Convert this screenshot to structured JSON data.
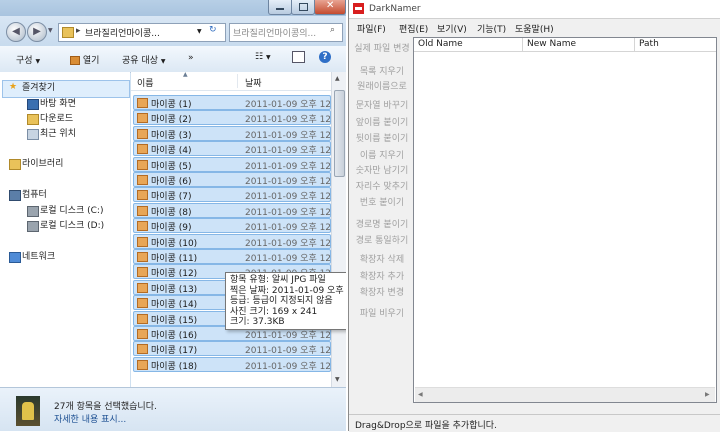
{
  "explorer": {
    "address": "브라질리언마이콩...",
    "search_placeholder": "브라질리언마이콩의...",
    "toolbar": {
      "organize": "구성",
      "open": "열기",
      "share": "공유 대상",
      "more": "»"
    },
    "nav": [
      {
        "label": "즐겨찾기",
        "icon": "star-icon"
      },
      {
        "label": "바탕 화면",
        "icon": "desktop-icon"
      },
      {
        "label": "다운로드",
        "icon": "download-icon"
      },
      {
        "label": "최근 위치",
        "icon": "recent-places-icon"
      },
      {
        "label": "라이브러리",
        "icon": "library-icon"
      },
      {
        "label": "컴퓨터",
        "icon": "computer-icon"
      },
      {
        "label": "로컬 디스크 (C:)",
        "icon": "drive-icon"
      },
      {
        "label": "로컬 디스크 (D:)",
        "icon": "drive-icon"
      },
      {
        "label": "네트워크",
        "icon": "network-icon"
      }
    ],
    "columns": {
      "name": "이름",
      "date": "날짜"
    },
    "files": [
      {
        "name": "마이콩 (1)",
        "date": "2011-01-09 오후 12:"
      },
      {
        "name": "마이콩 (2)",
        "date": "2011-01-09 오후 12:"
      },
      {
        "name": "마이콩 (3)",
        "date": "2011-01-09 오후 12:"
      },
      {
        "name": "마이콩 (4)",
        "date": "2011-01-09 오후 12:"
      },
      {
        "name": "마이콩 (5)",
        "date": "2011-01-09 오후 12:"
      },
      {
        "name": "마이콩 (6)",
        "date": "2011-01-09 오후 12:"
      },
      {
        "name": "마이콩 (7)",
        "date": "2011-01-09 오후 12:"
      },
      {
        "name": "마이콩 (8)",
        "date": "2011-01-09 오후 12:"
      },
      {
        "name": "마이콩 (9)",
        "date": "2011-01-09 오후 12:"
      },
      {
        "name": "마이콩 (10)",
        "date": "2011-01-09 오후 12:"
      },
      {
        "name": "마이콩 (11)",
        "date": "2011-01-09 오후 12:"
      },
      {
        "name": "마이콩 (12)",
        "date": "2011-01-09 오후 12:"
      },
      {
        "name": "마이콩 (13)",
        "date": ""
      },
      {
        "name": "마이콩 (14)",
        "date": ""
      },
      {
        "name": "마이콩 (15)",
        "date": ""
      },
      {
        "name": "마이콩 (16)",
        "date": "2011-01-09 오후 12:"
      },
      {
        "name": "마이콩 (17)",
        "date": "2011-01-09 오후 12:"
      },
      {
        "name": "마이콩 (18)",
        "date": "2011-01-09 오후 12:"
      }
    ],
    "tooltip": {
      "type": "항목 유형: 알씨 JPG 파일",
      "taken": "찍은 날짜: 2011-01-09 오후 12:31",
      "rating": "등급: 등급이 지정되지 않음",
      "dims": "사진 크기: 169 x 241",
      "size": "크기: 37.3KB"
    },
    "status": {
      "selected": "27개 항목을 선택했습니다.",
      "details_link": "자세한 내용 표시..."
    }
  },
  "darknamer": {
    "title": "DarkNamer",
    "menu": [
      "파일(F)",
      "편집(E)",
      "보기(V)",
      "기능(T)",
      "도움말(H)"
    ],
    "side_buttons": [
      "실제 파일 변경",
      "목록 지우기",
      "원래이름으로",
      "문자열 바꾸기",
      "앞이름 붙이기",
      "뒷이름 붙이기",
      "이름 지우기",
      "숫자만 남기기",
      "자리수 맞추기",
      "번호 붙이기",
      "경로명 붙이기",
      "경로 통일하기",
      "확장자 삭제",
      "확장자 추가",
      "확장자 변경",
      "파일 비우기"
    ],
    "columns": {
      "old": "Old Name",
      "new": "New Name",
      "path": "Path"
    },
    "status": "Drag&Drop으로 파일을 추가합니다."
  }
}
